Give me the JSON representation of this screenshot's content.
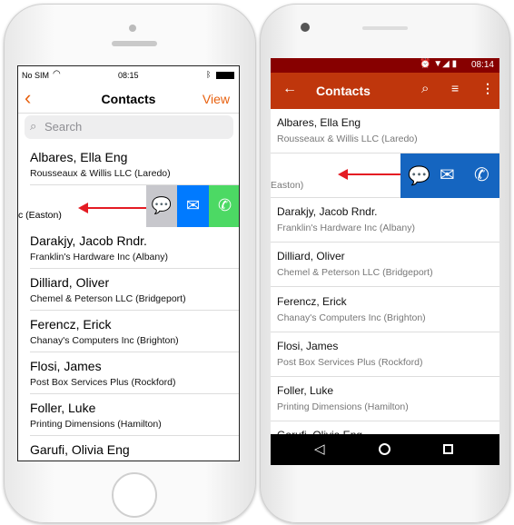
{
  "ios": {
    "status": {
      "carrier": "No SIM",
      "time": "08:15"
    },
    "nav": {
      "title": "Contacts",
      "right": "View"
    },
    "search": {
      "placeholder": "Search"
    },
    "swiped_text": "c (Easton)",
    "contacts": [
      {
        "name": "Albares, Ella Eng",
        "company": "Rousseaux & Willis LLC (Laredo)"
      },
      {
        "name": "Darakjy, Jacob Rndr.",
        "company": "Franklin's Hardware Inc (Albany)"
      },
      {
        "name": "Dilliard, Oliver",
        "company": "Chemel & Peterson LLC (Bridgeport)"
      },
      {
        "name": "Ferencz, Erick",
        "company": "Chanay's Computers Inc (Brighton)"
      },
      {
        "name": "Flosi, James",
        "company": "Post Box Services Plus (Rockford)"
      },
      {
        "name": "Foller, Luke",
        "company": "Printing Dimensions (Hamilton)"
      },
      {
        "name": "Garufi, Olivia Eng",
        "company": ""
      }
    ],
    "colors": {
      "accent": "#e8610f",
      "message": "#c7c7cc",
      "mail": "#007aff",
      "call": "#4cd964"
    }
  },
  "android": {
    "status": {
      "time": "08:14"
    },
    "toolbar": {
      "title": "Contacts"
    },
    "swiped_text": "Easton)",
    "contacts": [
      {
        "name": "Albares, Ella Eng",
        "company": "Rousseaux & Willis LLC (Laredo)"
      },
      {
        "name": "Darakjy, Jacob Rndr.",
        "company": "Franklin's Hardware Inc (Albany)"
      },
      {
        "name": "Dilliard, Oliver",
        "company": "Chemel & Peterson LLC (Bridgeport)"
      },
      {
        "name": "Ferencz, Erick",
        "company": "Chanay's Computers Inc (Brighton)"
      },
      {
        "name": "Flosi, James",
        "company": "Post Box Services Plus (Rockford)"
      },
      {
        "name": "Foller, Luke",
        "company": "Printing Dimensions (Hamilton)"
      },
      {
        "name": "Garufi, Olivia Eng",
        "company": ""
      }
    ],
    "colors": {
      "status": "#870000",
      "toolbar": "#bf360c",
      "actions": "#1565c0"
    }
  }
}
